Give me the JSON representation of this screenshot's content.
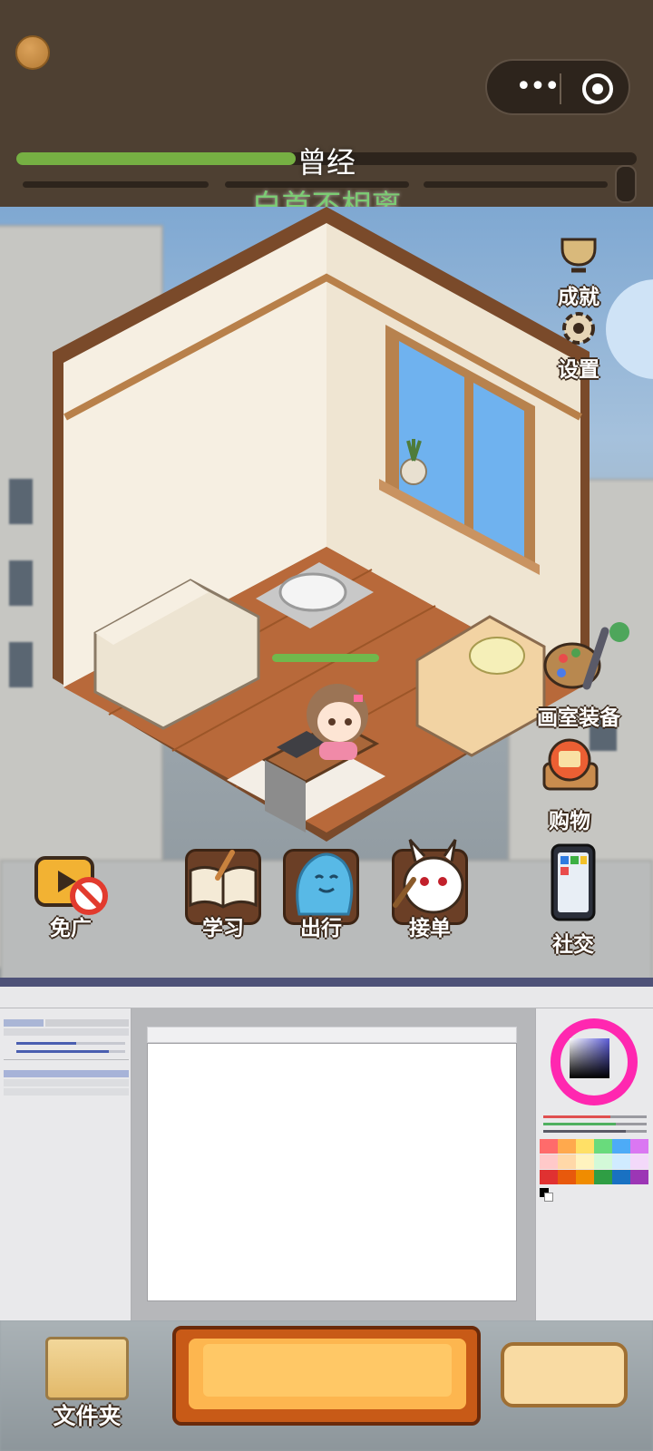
{
  "top_bar": {
    "era_label": "曾经",
    "era_name": "白首不相离",
    "main_progress": 0.45,
    "capsule_menu_icon": "more-dots-icon",
    "capsule_close_icon": "target-close-icon",
    "colors": {
      "bar_fill": "#76b043",
      "era_name": "#7ccc74",
      "background": "#4e4032"
    }
  },
  "side_menu": {
    "achievements": "成就",
    "settings": "设置",
    "studio_equipment": "画室装备",
    "shop": "购物",
    "social": "社交"
  },
  "bottom_menu": {
    "no_ads": "免广",
    "study": "学习",
    "travel": "出行",
    "take_order": "接单"
  },
  "drawing_app": {
    "accent_ring": "#ff27b0",
    "swatches": [
      "#ff6b6b",
      "#ffa94d",
      "#ffe066",
      "#69db7c",
      "#4dabf7",
      "#da77f2",
      "#ffc9c9",
      "#ffd8a8",
      "#fff3bf",
      "#d3f9d8",
      "#d0ebff",
      "#f3d9fa",
      "#e03131",
      "#e8590c",
      "#f08c00",
      "#2f9e44",
      "#1971c2",
      "#9c36b5"
    ]
  },
  "bottom_bar": {
    "folder": "文件夹"
  }
}
